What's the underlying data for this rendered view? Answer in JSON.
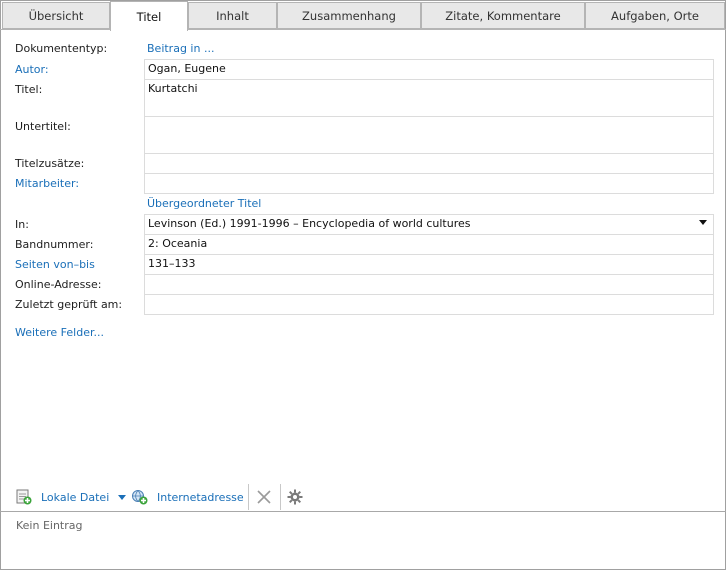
{
  "tabs": [
    {
      "label": "Übersicht"
    },
    {
      "label": "Titel"
    },
    {
      "label": "Inhalt"
    },
    {
      "label": "Zusammenhang"
    },
    {
      "label": "Zitate, Kommentare"
    },
    {
      "label": "Aufgaben, Orte"
    }
  ],
  "active_tab": "Titel",
  "form": {
    "doc_type_label": "Dokumententyp:",
    "doc_type_value": "Beitrag in ...",
    "author_label": "Autor:",
    "author_value": "Ogan, Eugene",
    "title_label": "Titel:",
    "title_value": "Kurtatchi",
    "subtitle_label": "Untertitel:",
    "subtitle_value": "",
    "title_additions_label": "Titelzusätze:",
    "title_additions_value": "",
    "contributors_label": "Mitarbeiter:",
    "contributors_value": "",
    "parent_title_header": "Übergeordneter Titel",
    "in_label": "In:",
    "in_value": "Levinson (Ed.) 1991-1996 – Encyclopedia of world cultures",
    "volume_label": "Bandnummer:",
    "volume_value": "2: Oceania",
    "pages_label": "Seiten von–bis",
    "pages_value": "131–133",
    "online_label": "Online-Adresse:",
    "online_value": "",
    "last_checked_label": "Zuletzt geprüft am:",
    "last_checked_value": "",
    "more_fields": "Weitere Felder..."
  },
  "toolbar": {
    "local_file": "Lokale Datei",
    "internet_address": "Internetadresse"
  },
  "status": {
    "empty_text": "Kein Eintrag"
  },
  "colors": {
    "link": "#1a6fb8",
    "tab_inactive": "#e8e8e8",
    "border": "#dcdcdc"
  }
}
